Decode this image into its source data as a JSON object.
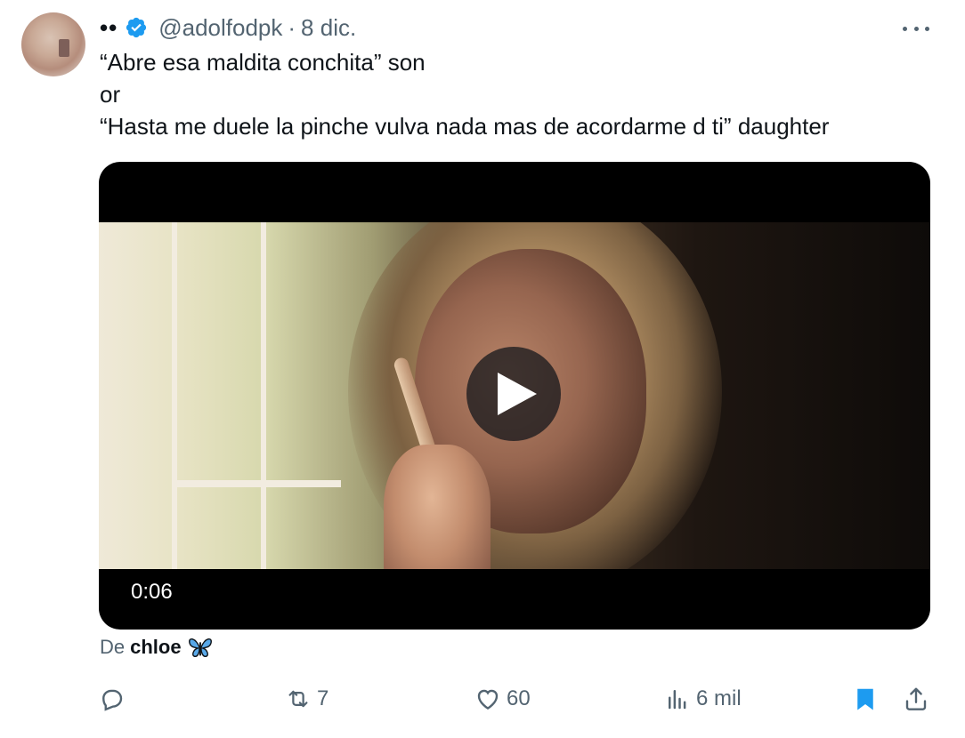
{
  "author": {
    "display_name": "••",
    "handle": "@adolfodpk",
    "separator": "·",
    "date": "8 dic."
  },
  "tweet": {
    "lines": [
      "“Abre esa maldita conchita” son",
      "or",
      "“Hasta me duele la pinche vulva nada mas de acordarme d ti” daughter"
    ]
  },
  "media": {
    "type": "video",
    "duration": "0:06",
    "play_icon": "play-icon"
  },
  "attribution": {
    "prefix": "De",
    "name": "chloe",
    "emoji_icon": "butterfly-icon"
  },
  "actions": {
    "reply_count": "",
    "retweet_count": "7",
    "like_count": "60",
    "views_count": "6 mil"
  },
  "colors": {
    "verified": "#1d9bf0",
    "bookmark_active": "#1d9bf0",
    "muted_text": "#536471",
    "main_text": "#0f1419"
  }
}
